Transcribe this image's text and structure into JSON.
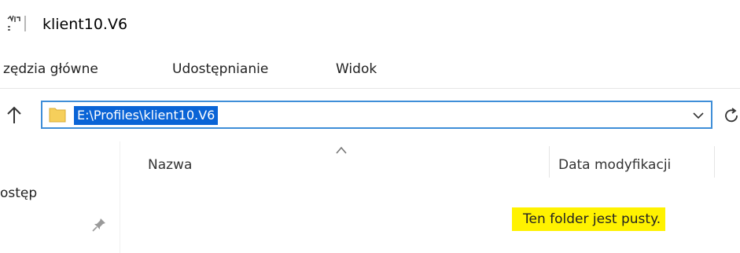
{
  "window": {
    "title": "klient10.V6",
    "icon": "folder-window-icon"
  },
  "ribbon": {
    "tabs": [
      "zędzia główne",
      "Udostępnianie",
      "Widok"
    ]
  },
  "address_bar": {
    "path": "E:\\Profiles\\klient10.V6",
    "selected": true
  },
  "nav_pane": {
    "item_label": "ostęp"
  },
  "columns": {
    "name": "Nazwa",
    "date": "Data modyfikacji"
  },
  "status": {
    "empty_message": "Ten folder jest pusty."
  },
  "colors": {
    "accent": "#0a64d6",
    "highlight": "#fff200",
    "border": "#3f8ed8"
  },
  "icons": [
    "up-arrow-icon",
    "folder-icon",
    "chevron-down-icon",
    "refresh-icon",
    "pin-icon",
    "sort-up-icon"
  ]
}
